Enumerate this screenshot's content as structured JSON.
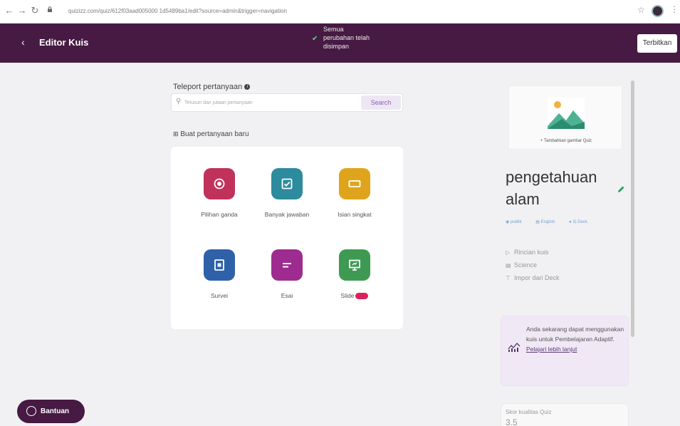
{
  "browser": {
    "back_icon": "arrow-left-icon",
    "forward_icon": "arrow-right-icon",
    "reload_icon": "reload-icon",
    "url": "quizizz.com/quiz/612f03aad005000 1d5489ba1/edit?source=admin&trigger=navigation"
  },
  "header": {
    "back_icon": "chevron-left-icon",
    "title": "Editor Kuis",
    "save_status": [
      "Semua",
      "perubahan telah",
      "disimpan"
    ],
    "publish_label": "Terbitkan",
    "color": "#461a42"
  },
  "teleport": {
    "label": "Teleport pertanyaan",
    "placeholder": "Telusuri dari jutaan pertanyaan",
    "button_label": "Search"
  },
  "new_question": {
    "label": "Buat pertanyaan baru",
    "types": [
      {
        "name": "multiple-choice",
        "label": "Pilihan ganda",
        "color": "#c0325b",
        "icon": "radio-icon"
      },
      {
        "name": "multi-answer",
        "label": "Banyak jawaban",
        "color": "#2d8b9e",
        "icon": "checkbox-icon"
      },
      {
        "name": "short-answer",
        "label": "Isian singkat",
        "color": "#e0a41c",
        "icon": "textbox-icon"
      },
      {
        "name": "survey",
        "label": "Survei",
        "color": "#2f61a8",
        "icon": "poll-icon"
      },
      {
        "name": "essay",
        "label": "Esai",
        "color": "#9e2b8f",
        "icon": "lines-icon"
      },
      {
        "name": "slide",
        "label": "Slide",
        "color": "#3e9a52",
        "icon": "presentation-icon",
        "badge": "new"
      }
    ]
  },
  "sidebar": {
    "cover_label": "+ Tambahkan gambar Quiz",
    "quiz_title": "pengetahuan alam",
    "meta": [
      "publik",
      "English",
      "3) Deck"
    ],
    "details": [
      "Rincian kuis",
      "Science",
      "Impor dari Deck"
    ],
    "promo_text": "Anda sekarang dapat menggunakan kuis untuk Pembelajaran Adaptif.",
    "promo_link": "Pelajari lebih lanjut",
    "quality_label": "Skor kualitas Quiz",
    "quality_value": "3.5"
  },
  "help": {
    "label": "Bantuan"
  }
}
